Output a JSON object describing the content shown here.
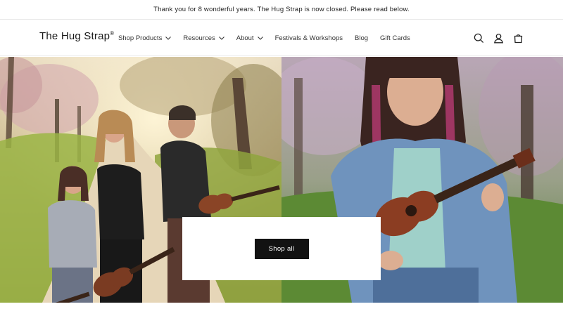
{
  "announcement": {
    "text": "Thank you for 8 wonderful years. The Hug Strap is now closed. Please read below."
  },
  "header": {
    "logo": "The Hug Strap",
    "logo_mark": "®",
    "nav": [
      {
        "label": "Shop Products",
        "has_dropdown": true
      },
      {
        "label": "Resources",
        "has_dropdown": true
      },
      {
        "label": "About",
        "has_dropdown": true
      },
      {
        "label": "Festivals & Workshops",
        "has_dropdown": false
      },
      {
        "label": "Blog",
        "has_dropdown": false
      },
      {
        "label": "Gift Cards",
        "has_dropdown": false
      }
    ],
    "icons": [
      "search-icon",
      "account-icon",
      "cart-icon"
    ]
  },
  "hero": {
    "button_label": "Shop all",
    "images": [
      "family-playing-ukuleles-photo",
      "girl-playing-ukulele-photo"
    ]
  },
  "colors": {
    "button_bg": "#121212",
    "text": "#121212",
    "border": "#e8e8e8"
  }
}
